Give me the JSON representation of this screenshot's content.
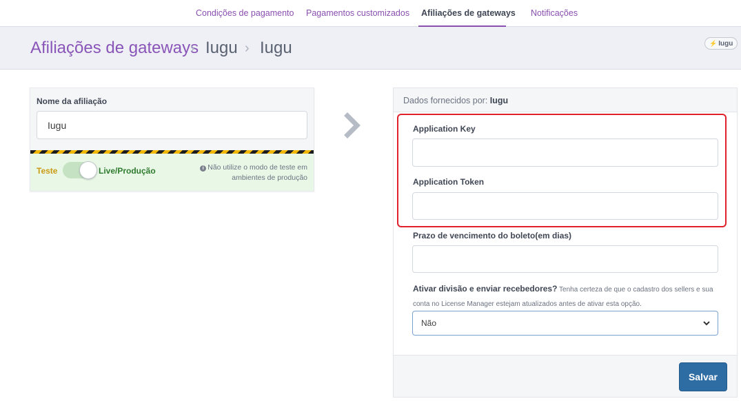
{
  "nav": {
    "tabs": [
      {
        "label": "Condições de pagamento"
      },
      {
        "label": "Pagamentos customizados"
      },
      {
        "label": "Afiliações de gateways"
      },
      {
        "label": "Notificações"
      }
    ],
    "active_tab": "Afiliações de gateways"
  },
  "header": {
    "breadcrumb": [
      "Afiliações de gateways",
      "Iugu",
      "Iugu"
    ],
    "badge_label": "Iugu",
    "badge_icon": "plug-icon"
  },
  "affiliation": {
    "name_label": "Nome da afiliação",
    "name_value": "Iugu",
    "mode_test_label": "Teste",
    "mode_live_label": "Live/Produção",
    "mode_live_enabled": true,
    "mode_info": "Não utilize o modo de teste em ambientes de produção"
  },
  "provider": {
    "title_prefix": "Dados fornecidos por:",
    "title_name": "Iugu",
    "app_key_label": "Application Key",
    "app_key_value": "",
    "app_token_label": "Application Token",
    "app_token_value": "",
    "due_days_label": "Prazo de vencimento do boleto(em dias)",
    "due_days_value": "",
    "split_label": "Ativar divisão e enviar recebedores?",
    "split_help": "Tenha certeza de que o cadastro dos sellers e sua conta no License Manager estejam atualizados antes de ativar esta opção.",
    "split_selected": "Não",
    "save_label": "Salvar"
  },
  "colors": {
    "accent": "#8a4fb0",
    "highlight_border": "#e0202a",
    "save_button": "#2e6ca4",
    "live_mode_bg": "#e9f7e7"
  }
}
